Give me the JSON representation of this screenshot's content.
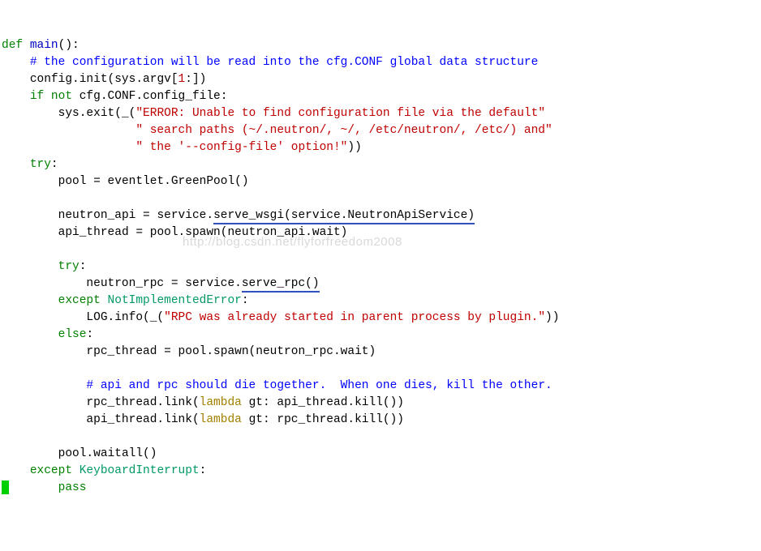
{
  "watermark": "http://blog.csdn.net/flyforfreedom2008",
  "t": {
    "def": "def",
    "main": "main",
    "mainSig": "():",
    "c1": "# the configuration will be read into the cfg.CONF global data structure",
    "cfgInitA": "config.init(sys.argv[",
    "one": "1",
    "cfgInitB": ":])",
    "if_": "if",
    "not_": "not",
    "ifCond": "cfg.CONF.config_file:",
    "sysExitA": "sys.exit(_(",
    "s1": "\"ERROR: Unable to find configuration file via the default\"",
    "s2": "\" search paths (~/.neutron/, ~/, /etc/neutron/, /etc/) and\"",
    "s3": "\" the '--config-file' option!\"",
    "sysExitB": "))",
    "try_": "try",
    "colon": ":",
    "pool": "pool = eventlet.GreenPool()",
    "napiA": "neutron_api = service.",
    "napiU": "serve_wsgi(service.NeutronApiService)",
    "apiThread": "api_thread = pool.spawn(neutron_api.wait)",
    "nrpcA": "neutron_rpc = service.",
    "nrpcU": "serve_rpc()",
    "except_": "except",
    "nie": "NotImplementedError",
    "logA": "LOG.info(_(",
    "s4": "\"RPC was already started in parent process by plugin.\"",
    "logB": "))",
    "else_": "else",
    "rpcThread": "rpc_thread = pool.spawn(neutron_rpc.wait)",
    "c2": "# api and rpc should die together.  When one dies, kill the other.",
    "link1a": "rpc_thread.link(",
    "lambda_": "lambda",
    "link1b": " gt: api_thread.kill())",
    "link2a": "api_thread.link(",
    "link2b": " gt: rpc_thread.kill())",
    "waitall": "pool.waitall()",
    "ki": "KeyboardInterrupt",
    "pass_": "pass"
  }
}
